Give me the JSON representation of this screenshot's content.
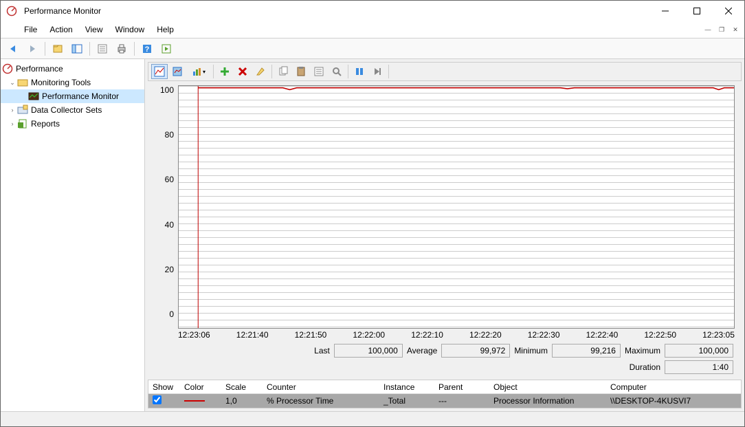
{
  "title": "Performance Monitor",
  "menu": {
    "file": "File",
    "action": "Action",
    "view": "View",
    "window": "Window",
    "help": "Help"
  },
  "tree": {
    "root": "Performance",
    "monitoring": "Monitoring Tools",
    "perfmon": "Performance Monitor",
    "dcs": "Data Collector Sets",
    "reports": "Reports"
  },
  "stats": {
    "last_label": "Last",
    "last": "100,000",
    "avg_label": "Average",
    "avg": "99,972",
    "min_label": "Minimum",
    "min": "99,216",
    "max_label": "Maximum",
    "max": "100,000",
    "dur_label": "Duration",
    "dur": "1:40"
  },
  "grid": {
    "h_show": "Show",
    "h_color": "Color",
    "h_scale": "Scale",
    "h_counter": "Counter",
    "h_instance": "Instance",
    "h_parent": "Parent",
    "h_object": "Object",
    "h_computer": "Computer",
    "r_scale": "1,0",
    "r_counter": "% Processor Time",
    "r_instance": "_Total",
    "r_parent": "---",
    "r_object": "Processor Information",
    "r_computer": "\\\\DESKTOP-4KUSVI7"
  },
  "chart_data": {
    "type": "line",
    "ylim": [
      0,
      100
    ],
    "yticks": [
      "100",
      "80",
      "60",
      "40",
      "20",
      "0"
    ],
    "xticks": [
      "12:23:06",
      "12:21:40",
      "12:21:50",
      "12:22:00",
      "12:22:10",
      "12:22:20",
      "12:22:30",
      "12:22:40",
      "12:22:50",
      "12:23:05"
    ],
    "series": [
      {
        "name": "% Processor Time",
        "color": "#c00000",
        "values_approx": "~100 throughout, minor dips to ~99.2"
      }
    ]
  }
}
